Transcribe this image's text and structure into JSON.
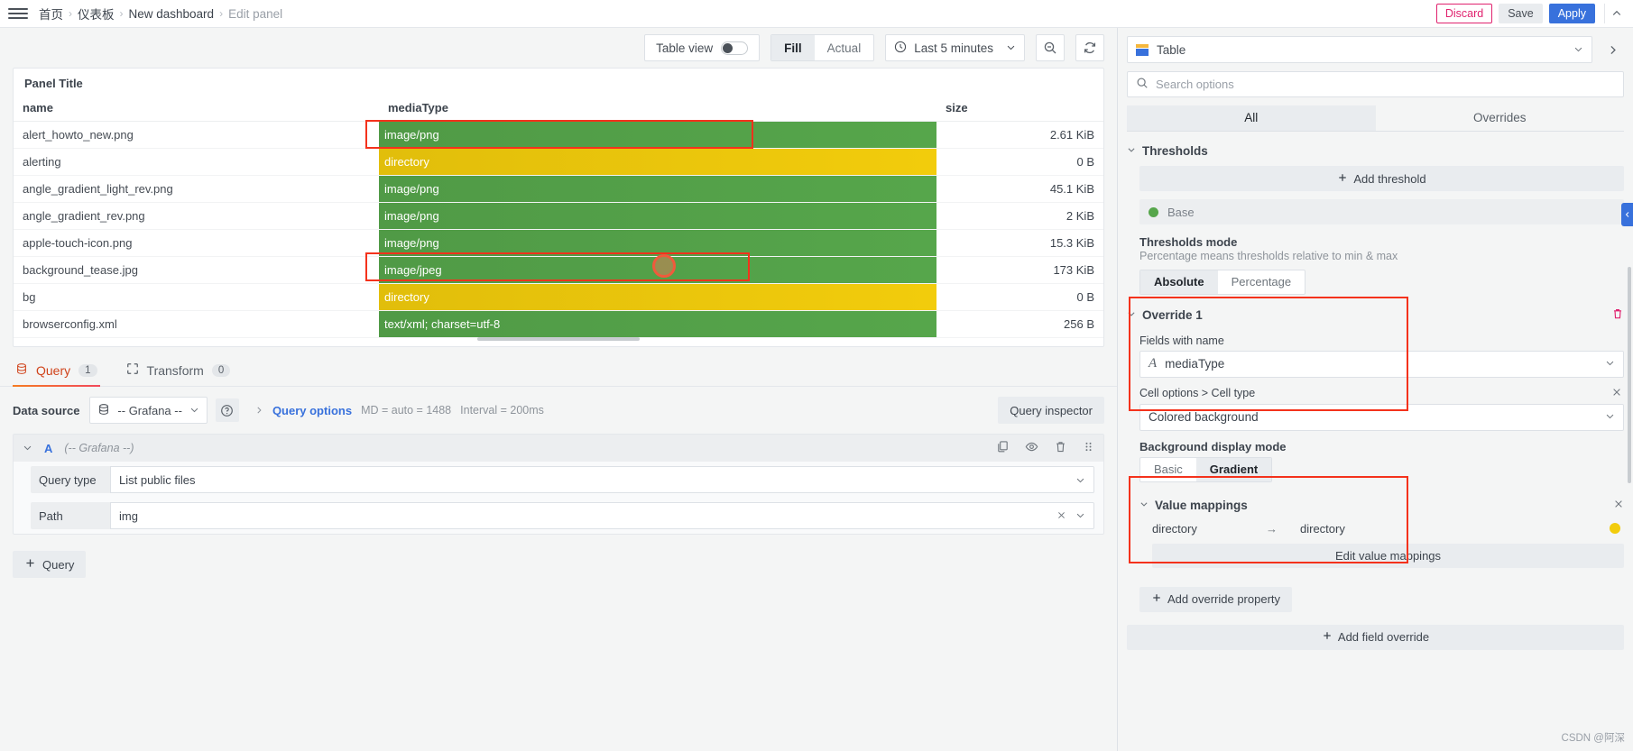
{
  "topnav": {
    "menu_icon": "hamburger-icon",
    "breadcrumbs": [
      {
        "label": "首页",
        "last": false
      },
      {
        "label": "仪表板",
        "last": false
      },
      {
        "label": "New dashboard",
        "last": false
      },
      {
        "label": "Edit panel",
        "last": true
      }
    ],
    "separator": "›",
    "discard_label": "Discard",
    "save_label": "Save",
    "apply_label": "Apply",
    "collapse_icon": "chevron-up-icon"
  },
  "toolbar": {
    "table_view_label": "Table view",
    "table_view_on": false,
    "fill_label": "Fill",
    "actual_label": "Actual",
    "fill_selected": true,
    "time_range": "Last 5 minutes",
    "clock_icon": "clock-icon",
    "time_chevron": "chevron-down-icon",
    "zoom_out_icon": "zoom-out-icon",
    "refresh_icon": "refresh-icon"
  },
  "panel": {
    "title": "Panel Title",
    "columns": [
      "name",
      "mediaType",
      "size"
    ],
    "rows": [
      {
        "name": "alert_howto_new.png",
        "mediaType": "image/png",
        "size": "2.61 KiB",
        "color": "#56a64b",
        "highlight": false
      },
      {
        "name": "alerting",
        "mediaType": "directory",
        "size": "0 B",
        "color": "#f2cc0c",
        "highlight": true
      },
      {
        "name": "angle_gradient_light_rev.png",
        "mediaType": "image/png",
        "size": "45.1 KiB",
        "color": "#56a64b",
        "highlight": false
      },
      {
        "name": "angle_gradient_rev.png",
        "mediaType": "image/png",
        "size": "2 KiB",
        "color": "#56a64b",
        "highlight": false
      },
      {
        "name": "apple-touch-icon.png",
        "mediaType": "image/png",
        "size": "15.3 KiB",
        "color": "#56a64b",
        "highlight": false
      },
      {
        "name": "background_tease.jpg",
        "mediaType": "image/jpeg",
        "size": "173 KiB",
        "color": "#56a64b",
        "highlight": false
      },
      {
        "name": "bg",
        "mediaType": "directory",
        "size": "0 B",
        "color": "#f2cc0c",
        "highlight": true
      },
      {
        "name": "browserconfig.xml",
        "mediaType": "text/xml; charset=utf-8",
        "size": "256 B",
        "color": "#56a64b",
        "highlight": false
      }
    ]
  },
  "query_tabs": [
    {
      "label": "Query",
      "count": "1",
      "icon": "database-icon",
      "active": true
    },
    {
      "label": "Transform",
      "count": "0",
      "icon": "transform-icon",
      "active": false
    }
  ],
  "query": {
    "datasource_label": "Data source",
    "datasource_value": "-- Grafana --",
    "datasource_icon": "database-icon",
    "help_icon": "help-circle-icon",
    "expand_icon": "chevron-right-icon",
    "query_options_label": "Query options",
    "md_text": "MD = auto = 1488",
    "interval_text": "Interval = 200ms",
    "query_inspector_label": "Query inspector",
    "refid": "A",
    "ref_datasource": "(-- Grafana --)",
    "row_actions": [
      "copy-icon",
      "eye-icon",
      "trash-icon",
      "drag-handle-icon"
    ],
    "query_type_label": "Query type",
    "query_type_value": "List public files",
    "path_label": "Path",
    "path_value": "img",
    "add_query_label": "Query",
    "add_icon": "plus-icon"
  },
  "options": {
    "viz_name": "Table",
    "viz_icon": "table-icon",
    "viz_next_icon": "chevron-right-icon",
    "search_placeholder": "Search options",
    "search_icon": "search-icon",
    "tab_all": "All",
    "tab_overrides": "Overrides",
    "thresholds": {
      "title": "Thresholds",
      "add_label": "Add threshold",
      "base_label": "Base",
      "base_color": "#56a64b",
      "mode_label": "Thresholds mode",
      "mode_desc": "Percentage means thresholds relative to min & max",
      "absolute_label": "Absolute",
      "percentage_label": "Percentage",
      "mode_selected": "Absolute"
    },
    "override": {
      "title": "Override 1",
      "trash_icon": "trash-icon",
      "fields_with_name_label": "Fields with name",
      "fields_with_name_value": "mediaType",
      "field_type_icon": "text-field-icon",
      "cell_options_label": "Cell options > Cell type",
      "cell_options_value": "Colored background",
      "bg_display_label": "Background display mode",
      "basic_label": "Basic",
      "gradient_label": "Gradient",
      "bg_display_selected": "Gradient",
      "value_mappings_label": "Value mappings",
      "mapping_from": "directory",
      "mapping_arrow": "→",
      "mapping_to": "directory",
      "mapping_color": "#f2cc0c",
      "edit_value_mappings_label": "Edit value mappings",
      "add_override_property_label": "Add override property",
      "add_field_override_label": "Add field override"
    }
  },
  "watermark": "CSDN @阿深"
}
